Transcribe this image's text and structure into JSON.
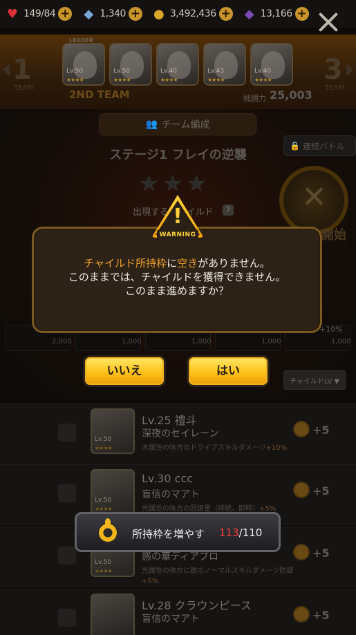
{
  "resources": [
    {
      "icon": "heart-icon",
      "value": "149/84"
    },
    {
      "icon": "gem-icon",
      "value": "1,340"
    },
    {
      "icon": "coin-icon",
      "value": "3,492,436"
    },
    {
      "icon": "crystal-icon",
      "value": "13,166"
    }
  ],
  "team": {
    "left_number": "1",
    "right_number": "3",
    "team_word": "TEAM",
    "leader_tag": "LEADER",
    "current_team": "2ND TEAM",
    "power_label": "戦闘力",
    "power_value": "25,003",
    "edit_label": "チーム編成",
    "portraits": [
      {
        "lv": "Lv.50"
      },
      {
        "lv": "Lv.50"
      },
      {
        "lv": "Lv.40"
      },
      {
        "lv": "Lv.43"
      },
      {
        "lv": "Lv.40"
      }
    ]
  },
  "stage": {
    "title": "ステージ1 フレイの逆襲",
    "appear_label": "出現するチャイルド",
    "repeat_battle": "連続バトル",
    "start_label": "開始",
    "bonus": "+10%",
    "costs": [
      "2,000",
      "1,000",
      "1,000",
      "1,000",
      "1,000"
    ]
  },
  "dialog": {
    "line1_pre": "チャイルド所持枠",
    "line1_mid": "に",
    "line1_hl": "空き",
    "line1_post": "がありません。",
    "line2": "このままでは、チャイルドを獲得できません。",
    "line3": "このまま進めますか？",
    "warning_label": "WARNING",
    "no_label": "いいえ",
    "yes_label": "はい"
  },
  "sort_label": "チャイルドLV ▼",
  "children": [
    {
      "lv": "Lv.25 禮斗",
      "name": "深夜のセイレーン",
      "desc": "木属性の味方のドライブスキルダメージ",
      "desc_hl": "+10%",
      "thumb_lv": "Lv.50",
      "bonus": "+5"
    },
    {
      "lv": "Lv.30 ccc",
      "name": "盲信のマアト",
      "desc": "光属性の味方の回復量（持続、即時）",
      "desc_hl": "+5%",
      "thumb_lv": "Lv.50",
      "bonus": "+5"
    },
    {
      "lv": "",
      "name": "惑の華ディアブロ",
      "desc": "光属性の味方に敵のノーマルスキルダメージ防御",
      "desc_hl": "+5%",
      "thumb_lv": "Lv.50",
      "bonus": "+5"
    },
    {
      "lv": "Lv.28 クラウンピース",
      "name": "盲信のマアト",
      "desc": "",
      "desc_hl": "",
      "thumb_lv": "",
      "bonus": "+5"
    }
  ],
  "slot_pill": {
    "label": "所持枠を増やす",
    "current": "113",
    "max": "/110"
  }
}
